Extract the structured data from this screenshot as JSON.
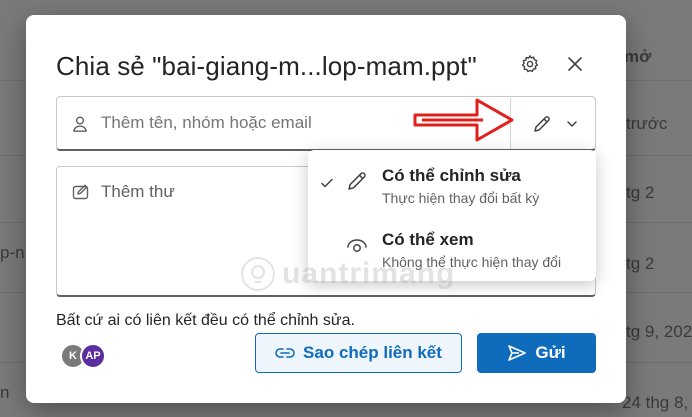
{
  "background": {
    "column_header": "mở",
    "right_cells": [
      "trước",
      "tg 2",
      "tg 2",
      "tg 9, 202",
      "24 thg 8, 202"
    ],
    "left_cells": [
      "p-n",
      "n"
    ]
  },
  "dialog": {
    "title": "Chia sẻ \"bai-giang-m...lop-mam.ppt\"",
    "people_placeholder": "Thêm tên, nhóm hoặc email",
    "message_placeholder": "Thêm thư",
    "link_info": "Bất cứ ai có liên kết đều có thể chỉnh sửa.",
    "avatars": [
      {
        "initials": "K",
        "color": "#7a7a7a"
      },
      {
        "initials": "AP",
        "color": "#5b2d9e"
      }
    ],
    "copy_link_label": "Sao chép liên kết",
    "send_label": "Gửi"
  },
  "permission_menu": {
    "items": [
      {
        "title": "Có thể chỉnh sửa",
        "subtitle": "Thực hiện thay đổi bất kỳ",
        "selected": true,
        "icon": "pencil-icon"
      },
      {
        "title": "Có thể xem",
        "subtitle": "Không thể thực hiện thay đổi",
        "selected": false,
        "icon": "eye-icon"
      }
    ]
  },
  "watermark": {
    "text": "uantrimang"
  },
  "colors": {
    "accent": "#0f6cbd",
    "annotation": "#e0201b"
  }
}
